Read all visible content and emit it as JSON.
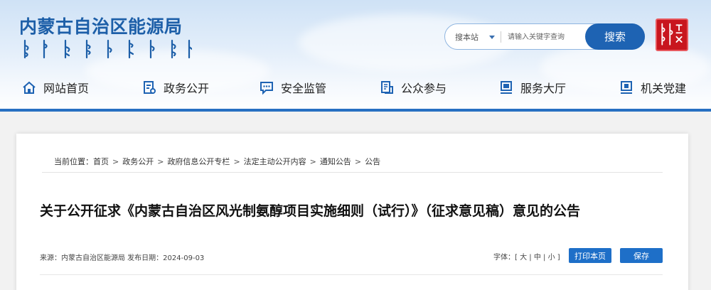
{
  "header": {
    "site_title": "内蒙古自治区能源局",
    "colors": {
      "brand": "#1d5fa8",
      "accent": "#2870c2",
      "seal": "#c8161e"
    }
  },
  "search": {
    "scope_label": "搜本站",
    "placeholder": "请输入关键字查询",
    "button_label": "搜索"
  },
  "nav": {
    "items": [
      {
        "label": "网站首页",
        "icon": "home-icon"
      },
      {
        "label": "政务公开",
        "icon": "document-icon"
      },
      {
        "label": "安全监管",
        "icon": "chat-icon"
      },
      {
        "label": "公众参与",
        "icon": "file-icon"
      },
      {
        "label": "服务大厅",
        "icon": "monitor-icon"
      },
      {
        "label": "机关党建",
        "icon": "party-icon"
      }
    ]
  },
  "breadcrumb": {
    "prefix": "当前位置：",
    "items": [
      "首页",
      "政务公开",
      "政府信息公开专栏",
      "法定主动公开内容",
      "通知公告",
      "公告"
    ]
  },
  "article": {
    "title": "关于公开征求《内蒙古自治区风光制氨醇项目实施细则（试行）》（征求意见稿）意见的公告",
    "meta": "来源：内蒙古自治区能源局 发布日期：2024-09-03",
    "font_size_label": "字体：[",
    "font_large": "大",
    "font_medium": "中",
    "font_small": "小",
    "font_sep": "|",
    "font_close": "]",
    "print_label": "打印本页",
    "save_label": "保存"
  }
}
